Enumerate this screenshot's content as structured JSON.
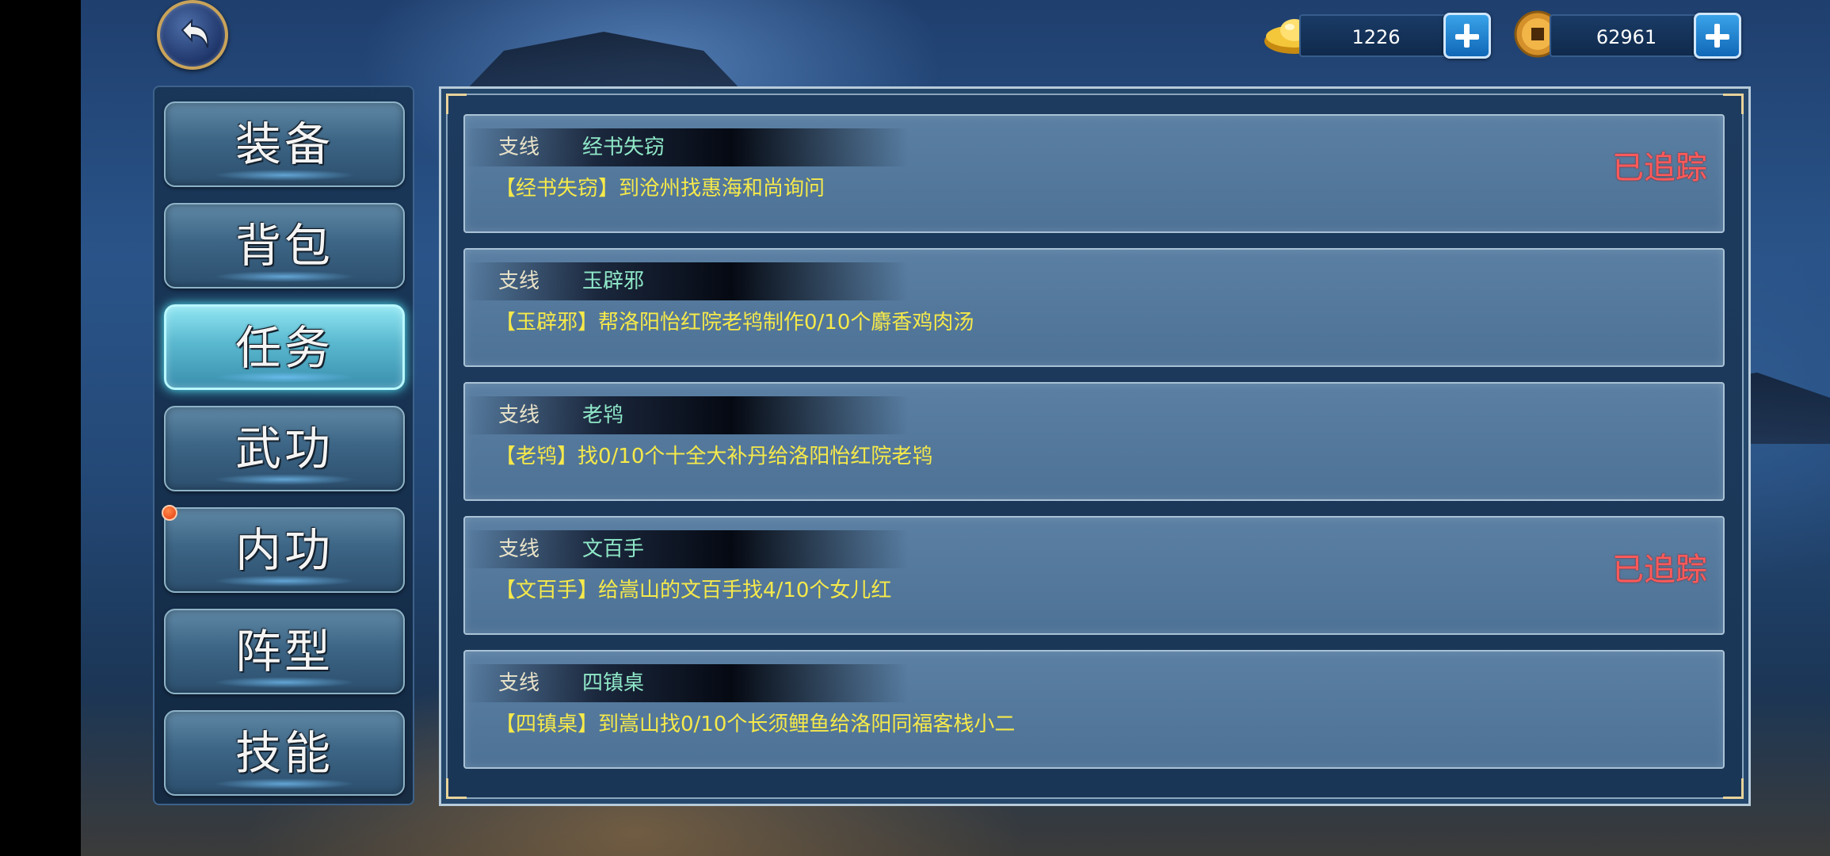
{
  "currency": {
    "ingot_value": "1226",
    "coin_value": "62961"
  },
  "nav": {
    "items": [
      {
        "label": "装备",
        "active": false
      },
      {
        "label": "背包",
        "active": false
      },
      {
        "label": "任务",
        "active": true
      },
      {
        "label": "武功",
        "active": false
      },
      {
        "label": "内功",
        "active": false,
        "notification": true
      },
      {
        "label": "阵型",
        "active": false
      },
      {
        "label": "技能",
        "active": false
      }
    ]
  },
  "quests": [
    {
      "type": "支线",
      "name": "经书失窃",
      "desc": "【经书失窃】到沧州找惠海和尚询问",
      "status": "已追踪"
    },
    {
      "type": "支线",
      "name": "玉辟邪",
      "desc": "【玉辟邪】帮洛阳怡红院老鸨制作0/10个麝香鸡肉汤",
      "status": ""
    },
    {
      "type": "支线",
      "name": "老鸨",
      "desc": "【老鸨】找0/10个十全大补丹给洛阳怡红院老鸨",
      "status": ""
    },
    {
      "type": "支线",
      "name": "文百手",
      "desc": "【文百手】给嵩山的文百手找4/10个女儿红",
      "status": "已追踪"
    },
    {
      "type": "支线",
      "name": "四镇桌",
      "desc": "【四镇桌】到嵩山找0/10个长须鲤鱼给洛阳同福客栈小二",
      "status": ""
    }
  ],
  "colors": {
    "quest_desc": "#f6e94a",
    "quest_name": "#8fe8c8",
    "tracked": "#ff5a5a",
    "nav_active": "#8fe6f2"
  }
}
